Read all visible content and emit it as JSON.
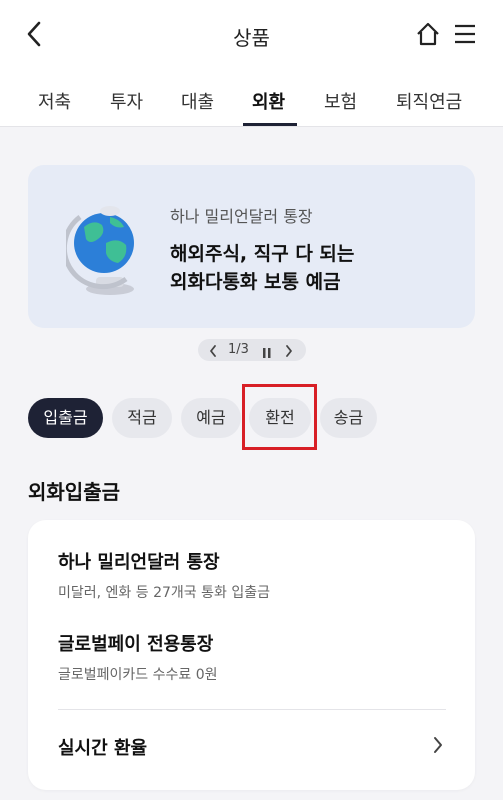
{
  "header": {
    "title": "상품"
  },
  "tabs": [
    {
      "label": "저축"
    },
    {
      "label": "투자"
    },
    {
      "label": "대출"
    },
    {
      "label": "외환"
    },
    {
      "label": "보험"
    },
    {
      "label": "퇴직연금"
    }
  ],
  "active_tab": "외환",
  "banner": {
    "subtitle": "하나 밀리언달러 통장",
    "title_line1": "해외주식, 직구 다 되는",
    "title_line2": "외화다통화 보통 예금"
  },
  "pager": {
    "text": "1/3"
  },
  "chips": [
    {
      "label": "입출금"
    },
    {
      "label": "적금"
    },
    {
      "label": "예금"
    },
    {
      "label": "환전"
    },
    {
      "label": "송금"
    }
  ],
  "active_chip": "입출금",
  "section": {
    "title": "외화입출금"
  },
  "products": [
    {
      "title": "하나 밀리언달러 통장",
      "desc": "미달러, 엔화 등 27개국 통화 입출금"
    },
    {
      "title": "글로벌페이 전용통장",
      "desc": "글로벌페이카드 수수료 0원"
    }
  ],
  "rate_link": {
    "label": "실시간 환율"
  },
  "colors": {
    "dark_navy": "#1e2235",
    "banner_bg": "#e6ebf6",
    "chip_bg": "#e7e8ed",
    "highlight_red": "#d81f26"
  },
  "icons": [
    "back-arrow-icon",
    "home-icon",
    "hamburger-menu-icon",
    "globe-icon",
    "chevron-left-icon",
    "pause-icon",
    "chevron-right-icon"
  ]
}
